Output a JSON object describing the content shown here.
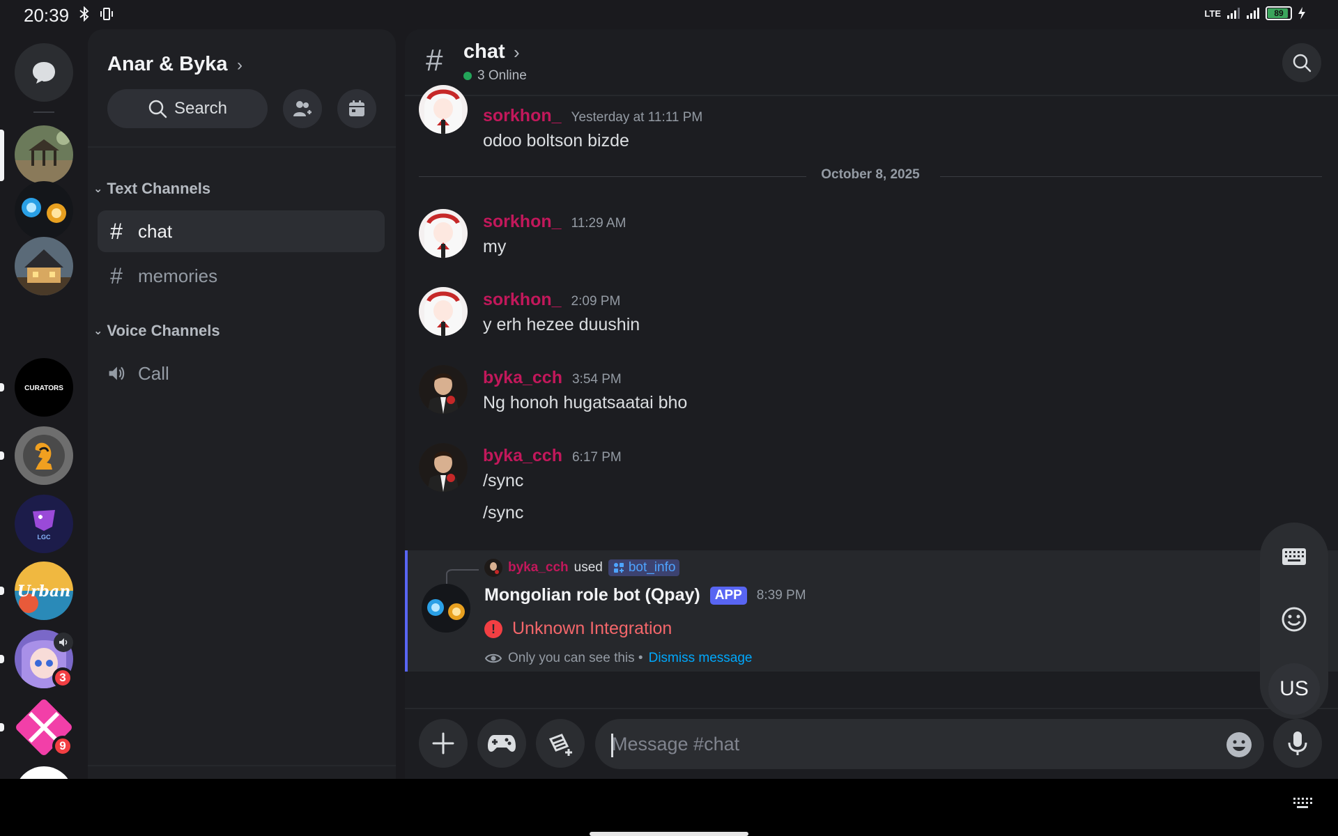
{
  "status_bar": {
    "time": "20:39",
    "network": "LTE",
    "battery": "89",
    "icons": [
      "bluetooth-icon",
      "vibrate-icon",
      "signal-icon",
      "signal-icon",
      "battery-icon",
      "charging-icon"
    ]
  },
  "server_rail": {
    "servers": [
      {
        "name": "server-gazebo"
      },
      {
        "name": "server-orbs"
      },
      {
        "name": "server-house"
      },
      {
        "name": "server-curators",
        "label": "CURATORS"
      },
      {
        "name": "server-chess"
      },
      {
        "name": "server-lgc",
        "label": "LGC"
      },
      {
        "name": "server-urban",
        "label": "Urban"
      },
      {
        "name": "server-anime",
        "badge": "3"
      },
      {
        "name": "server-pink",
        "badge": "9"
      },
      {
        "name": "server-tiktok"
      }
    ]
  },
  "sidebar": {
    "guild_name": "Anar & Byka",
    "search_label": "Search",
    "categories": [
      {
        "label": "Text Channels"
      },
      {
        "label": "Voice Channels"
      }
    ],
    "channels": [
      {
        "label": "chat",
        "active": true
      },
      {
        "label": "memories"
      },
      {
        "label": "Call"
      }
    ]
  },
  "header": {
    "channel": "chat",
    "online": "3 Online"
  },
  "messages": [
    {
      "user": "sorkhon_",
      "time": "Yesterday at 11:11 PM",
      "lines": [
        "odoo boltson bizde"
      ]
    },
    {
      "user": "sorkhon_",
      "time": "11:29 AM",
      "lines": [
        "my"
      ]
    },
    {
      "user": "sorkhon_",
      "time": "2:09 PM",
      "lines": [
        "y erh hezee duushin"
      ]
    },
    {
      "user": "byka_cch",
      "time": "3:54 PM",
      "lines": [
        "Ng honoh hugatsaatai bho"
      ]
    },
    {
      "user": "byka_cch",
      "time": "6:17 PM",
      "lines": [
        "/sync",
        "/sync"
      ]
    }
  ],
  "date_divider": "October 8, 2025",
  "bot_message": {
    "used_by": "byka_cch",
    "used_word": "used",
    "command": "bot_info",
    "bot_name": "Mongolian role bot (Qpay)",
    "badge": "APP",
    "time": "8:39 PM",
    "error": "Unknown Integration",
    "only_you": "Only you can see this •",
    "dismiss": "Dismiss message"
  },
  "keyboard_panel": {
    "layout": "US"
  },
  "composer": {
    "placeholder": "Message #chat"
  },
  "colors": {
    "username": "#c2185b",
    "accent": "#5865f2",
    "error": "#f4676b",
    "link": "#00a8fc",
    "online": "#23a559"
  }
}
